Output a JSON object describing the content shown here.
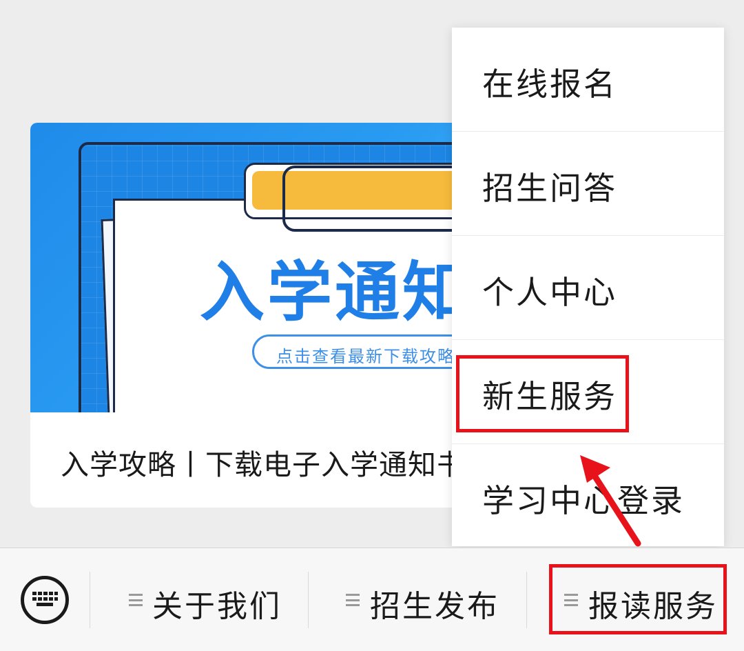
{
  "article": {
    "cover_title": "入学通知",
    "cover_subtitle": "点击查看最新下载攻略",
    "title": "入学攻略丨下载电子入学通知书"
  },
  "popup_menu": {
    "items": [
      {
        "label": "在线报名"
      },
      {
        "label": "招生问答"
      },
      {
        "label": "个人中心"
      },
      {
        "label": "新生服务"
      },
      {
        "label": "学习中心登录"
      }
    ]
  },
  "bottom_menu": {
    "keyboard_icon": "keyboard-icon",
    "items": [
      {
        "label": "关于我们"
      },
      {
        "label": "招生发布"
      },
      {
        "label": "报读服务"
      }
    ]
  },
  "colors": {
    "highlight": "#e8121b",
    "cover_blue": "#1f8bea",
    "clip_yellow": "#f6bb3c"
  }
}
